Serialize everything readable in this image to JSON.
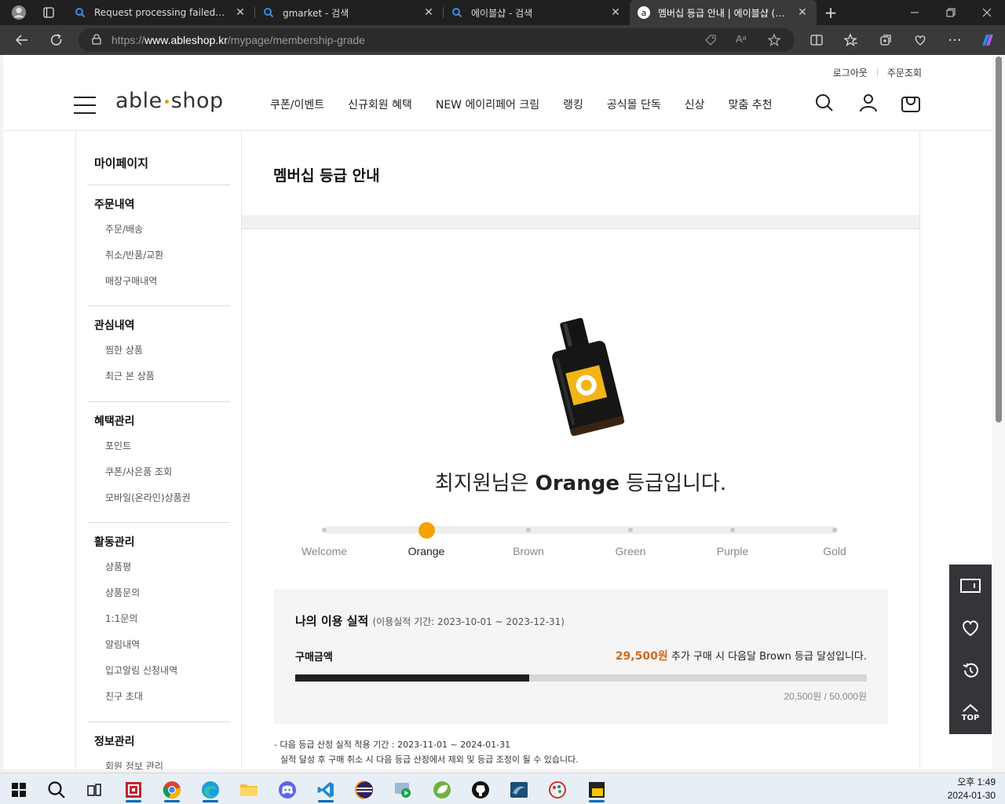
{
  "browser": {
    "tabs": [
      {
        "title": "Request processing failed; nested"
      },
      {
        "title": "gmarket - 검색"
      },
      {
        "title": "에이블샵 - 검색"
      },
      {
        "title": "멤버십 등급 안내 | 에이블샵 (able"
      }
    ],
    "url_prefix": "https://",
    "url_host": "www.ableshop.kr",
    "url_path": "/mypage/membership-grade",
    "new_tab_label": "+"
  },
  "header": {
    "util": [
      "로그아웃",
      "주문조회"
    ],
    "logo_left": "able",
    "logo_right": "shop",
    "menu": [
      "쿠폰/이벤트",
      "신규회원 혜택",
      "NEW 에이리페어 크림",
      "랭킹",
      "공식몰 단독",
      "신상",
      "맞춤 추천"
    ]
  },
  "sidebar": {
    "title": "마이페이지",
    "sections": [
      {
        "heading": "주문내역",
        "items": [
          "주문/배송",
          "취소/반품/교환",
          "매장구매내역"
        ]
      },
      {
        "heading": "관심내역",
        "items": [
          "찜한 상품",
          "최근 본 상품"
        ]
      },
      {
        "heading": "혜택관리",
        "items": [
          "포인트",
          "쿠폰/사은품 조회",
          "모바일(온라인)상품권"
        ]
      },
      {
        "heading": "활동관리",
        "items": [
          "상품평",
          "상품문의",
          "1:1문의",
          "알림내역",
          "입고알림 신청내역",
          "친구 초대"
        ]
      },
      {
        "heading": "정보관리",
        "items": [
          "회원 정보 관리"
        ]
      }
    ]
  },
  "main": {
    "title": "멤버십 등급 안내",
    "grade_prefix": "최지원님은 ",
    "grade_name": "Orange",
    "grade_suffix": " 등급입니다.",
    "grades": [
      "Welcome",
      "Orange",
      "Brown",
      "Green",
      "Purple",
      "Gold"
    ],
    "current_grade_index": 1,
    "performance": {
      "heading": "나의 이용 실적",
      "period": "(이용실적 기간: 2023-10-01 ~ 2023-12-31)",
      "label": "구매금액",
      "amount_needed": "29,500원",
      "message": " 추가 구매 시 다음달 Brown 등급 달성입니다.",
      "current_over_target": "20,500원 / 50,000원",
      "progress_fraction": 0.41
    },
    "notes": [
      "- 다음 등급 산정 실적 적용 기간 : 2023-11-01 ~ 2024-01-31",
      "실적 달성 후 구매 취소 시 다음 등급 산정에서 제외 및 등급 조정이 될 수 있습니다."
    ]
  },
  "quick_menu": {
    "top_label": "TOP"
  },
  "taskbar": {
    "time": "오후 1:49",
    "date": "2024-01-30"
  },
  "colors": {
    "accent": "#f5a300",
    "amount": "#d2691e",
    "bar": "#1f1f1f"
  }
}
